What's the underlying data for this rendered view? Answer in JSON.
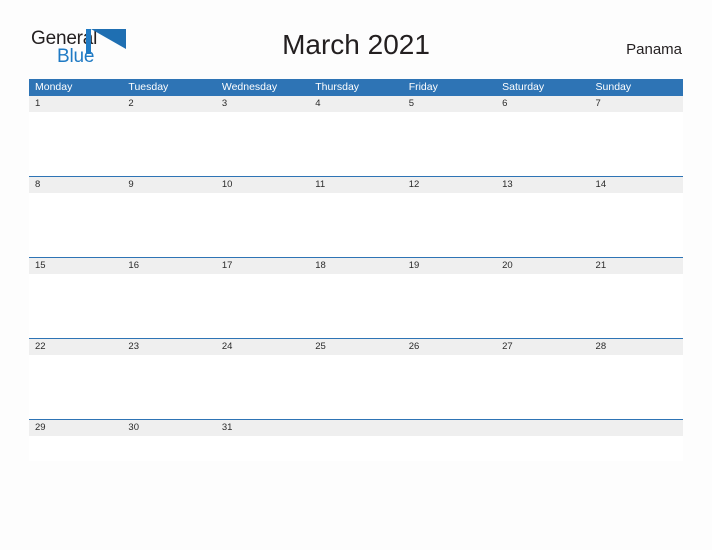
{
  "brand": {
    "name_part1": "General",
    "name_part2": "Blue",
    "flag_icon": "blue-flag-triangle-icon",
    "accent_color": "#1f7ac4"
  },
  "header": {
    "title": "March 2021",
    "month": "March",
    "year": "2021",
    "country": "Panama"
  },
  "colors": {
    "header_blue": "#2e74b5",
    "date_band_gray": "#efefef",
    "page_background": "#fdfdfd",
    "text_dark": "#231f20"
  },
  "calendar": {
    "weekdays": [
      "Monday",
      "Tuesday",
      "Wednesday",
      "Thursday",
      "Friday",
      "Saturday",
      "Sunday"
    ],
    "weeks": [
      [
        "1",
        "2",
        "3",
        "4",
        "5",
        "6",
        "7"
      ],
      [
        "8",
        "9",
        "10",
        "11",
        "12",
        "13",
        "14"
      ],
      [
        "15",
        "16",
        "17",
        "18",
        "19",
        "20",
        "21"
      ],
      [
        "22",
        "23",
        "24",
        "25",
        "26",
        "27",
        "28"
      ],
      [
        "29",
        "30",
        "31",
        "",
        "",
        "",
        ""
      ]
    ]
  }
}
